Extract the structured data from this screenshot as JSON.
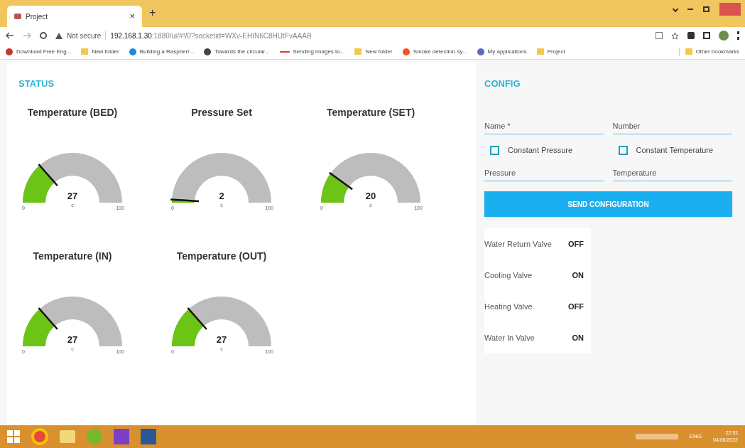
{
  "browser": {
    "tab_title": "Project",
    "tab_close": "×",
    "new_tab": "+",
    "security": "Not secure",
    "url_host": "192.168.1.30",
    "url_rest": ":1880/ui/#!/0?socketid=WXv-EHIN6C8HUtFvAAAB",
    "bookmarks": [
      {
        "label": "Download Free Eng...",
        "kind": "site",
        "color": "#c0392b"
      },
      {
        "label": "New folder",
        "kind": "folder"
      },
      {
        "label": "Building a Raspberr...",
        "kind": "site",
        "color": "#1e88e5"
      },
      {
        "label": "Towards the circular...",
        "kind": "site",
        "color": "#444444"
      },
      {
        "label": "Sending images to...",
        "kind": "line",
        "color": "#e53935"
      },
      {
        "label": "New folder",
        "kind": "folder"
      },
      {
        "label": "Smoke detection sy...",
        "kind": "site",
        "color": "#f4511e"
      },
      {
        "label": "My applications",
        "kind": "site",
        "color": "#5c6bc0"
      },
      {
        "label": "Project",
        "kind": "folder"
      }
    ],
    "other_bookmarks": "Other bookmarks"
  },
  "status": {
    "title": "STATUS",
    "gauges": [
      {
        "title": "Temperature (BED)",
        "value": "27",
        "unit": "c",
        "min": "0",
        "max": "100"
      },
      {
        "title": "Pressure Set",
        "value": "2",
        "unit": "c",
        "min": "0",
        "max": "100"
      },
      {
        "title": "Temperature (SET)",
        "value": "20",
        "unit": "c",
        "min": "0",
        "max": "100"
      },
      {
        "title": "Temperature (IN)",
        "value": "27",
        "unit": "c",
        "min": "0",
        "max": "100"
      },
      {
        "title": "Temperature (OUT)",
        "value": "27",
        "unit": "c",
        "min": "0",
        "max": "100"
      }
    ]
  },
  "config": {
    "title": "CONFIG",
    "fields_top": [
      {
        "placeholder": "Name *"
      },
      {
        "placeholder": "Number"
      }
    ],
    "checkboxes": [
      {
        "label": "Constant Pressure",
        "checked": false
      },
      {
        "label": "Constant Temperature",
        "checked": false
      }
    ],
    "fields_bottom": [
      {
        "placeholder": "Pressure"
      },
      {
        "placeholder": "Temperature"
      }
    ],
    "button": "SEND CONFIGURATION",
    "valves": [
      {
        "name": "Water Return Valve",
        "state": "OFF"
      },
      {
        "name": "Cooling Valve",
        "state": "ON"
      },
      {
        "name": "Heating Valve",
        "state": "OFF"
      },
      {
        "name": "Water In Valve",
        "state": "ON"
      }
    ]
  },
  "taskbar": {
    "language": "ENG",
    "time": "22:53",
    "date": "04/06/2022"
  }
}
